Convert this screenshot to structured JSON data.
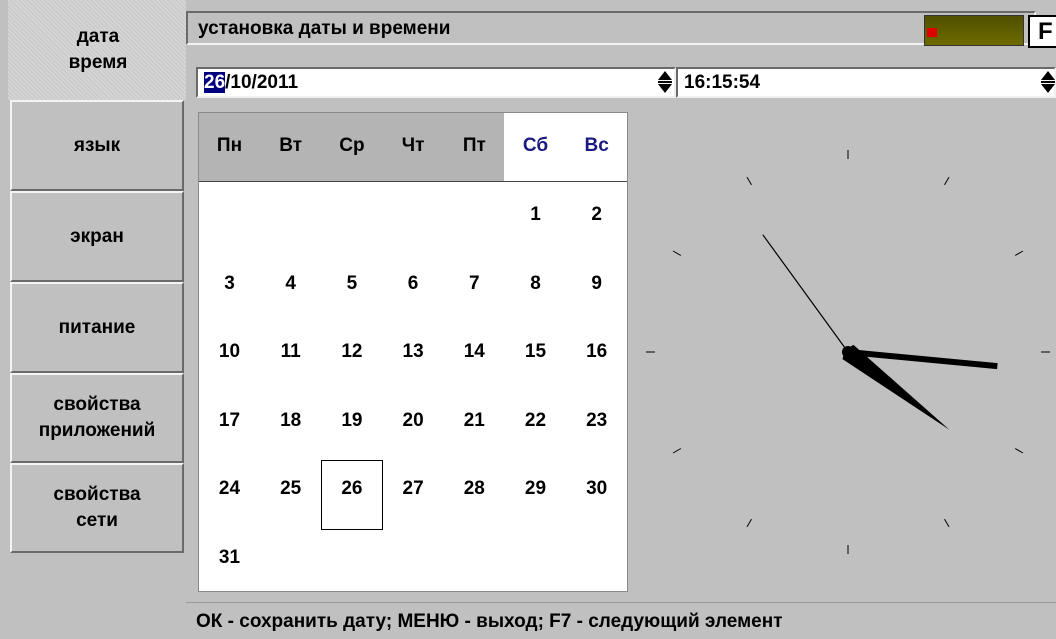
{
  "sidebar": {
    "items": [
      {
        "label": "дата\nвремя",
        "active": true
      },
      {
        "label": "язык"
      },
      {
        "label": "экран"
      },
      {
        "label": "питание"
      },
      {
        "label": "свойства\nприложений"
      },
      {
        "label": "свойства\nсети"
      }
    ]
  },
  "header": {
    "title": "установка даты и времени",
    "f_key_label": "F"
  },
  "date_input": {
    "day": "26",
    "rest": "/10/2011"
  },
  "time_input": {
    "value": "16:15:54"
  },
  "calendar": {
    "weekdays": [
      "Пн",
      "Вт",
      "Ср",
      "Чт",
      "Пт",
      "Сб",
      "Вс"
    ],
    "weekend_color": "#1a1a80",
    "selected_day": 26,
    "rows": [
      [
        "",
        "",
        "",
        "",
        "",
        "1",
        "2"
      ],
      [
        "3",
        "4",
        "5",
        "6",
        "7",
        "8",
        "9"
      ],
      [
        "10",
        "11",
        "12",
        "13",
        "14",
        "15",
        "16"
      ],
      [
        "17",
        "18",
        "19",
        "20",
        "21",
        "22",
        "23"
      ],
      [
        "24",
        "25",
        "26",
        "27",
        "28",
        "29",
        "30"
      ],
      [
        "31",
        "",
        "",
        "",
        "",
        "",
        ""
      ]
    ]
  },
  "clock": {
    "hours": 16,
    "minutes": 15,
    "seconds": 54
  },
  "status": {
    "text": "ОК - сохранить дату; МЕНЮ - выход; F7 - следующий элемент"
  }
}
